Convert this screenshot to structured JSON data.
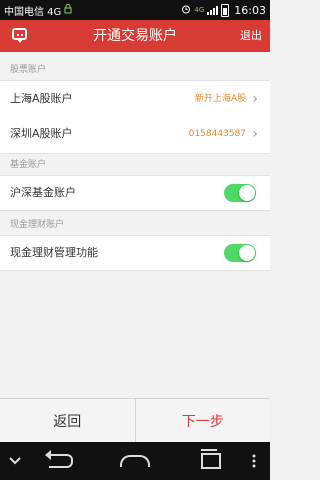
{
  "status_bar": {
    "carrier": "中国电信 4G",
    "network_badge": "4G",
    "time": "16:03"
  },
  "header": {
    "title": "开通交易账户",
    "logout_label": "退出",
    "left_icon": "chat-bubble-icon",
    "background_color": "#d83a34"
  },
  "sections": {
    "stock": {
      "label": "股票账户",
      "rows": [
        {
          "label": "上海A股账户",
          "value": "新开上海A股"
        },
        {
          "label": "深圳A股账户",
          "value": "0158443587"
        }
      ]
    },
    "fund": {
      "label": "基金账户",
      "rows": [
        {
          "label": "沪深基金账户",
          "toggle_on": true
        }
      ]
    },
    "cash": {
      "label": "现金理财账户",
      "rows": [
        {
          "label": "现金理财管理功能",
          "toggle_on": true
        }
      ]
    }
  },
  "bottom_bar": {
    "back_label": "返回",
    "next_label": "下一步"
  },
  "colors": {
    "accent": "#d83a34",
    "value_text": "#e08a2a",
    "toggle_on": "#4cd964"
  }
}
